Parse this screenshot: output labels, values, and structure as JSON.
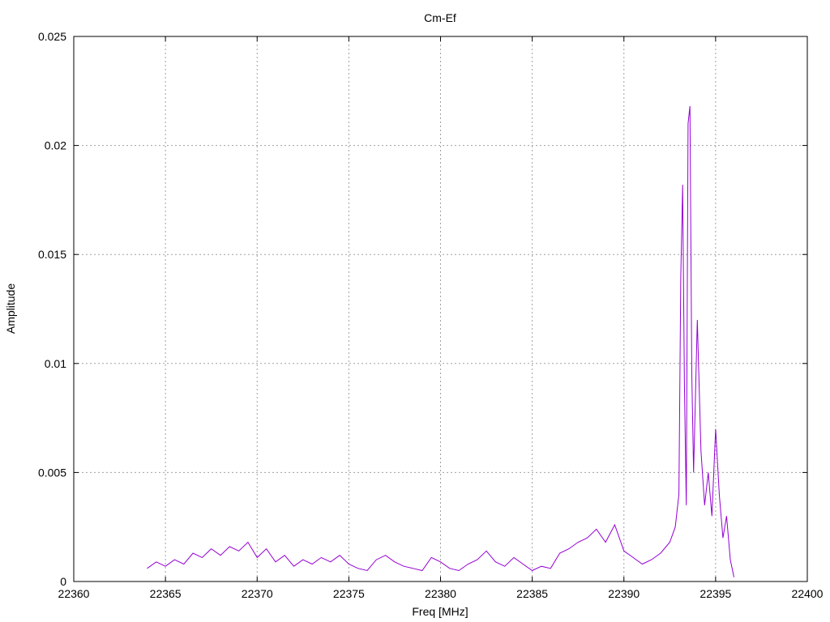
{
  "chart_data": {
    "type": "line",
    "title": "Cm-Ef",
    "xlabel": "Freq [MHz]",
    "ylabel": "Amplitude",
    "xlim": [
      22360,
      22400
    ],
    "ylim": [
      0,
      0.025
    ],
    "xticks": [
      22360,
      22365,
      22370,
      22375,
      22380,
      22385,
      22390,
      22395,
      22400
    ],
    "yticks": [
      0,
      0.005,
      0.01,
      0.015,
      0.02,
      0.025
    ],
    "xtick_labels": [
      "22360",
      "22365",
      "22370",
      "22375",
      "22380",
      "22385",
      "22390",
      "22395",
      "22400"
    ],
    "ytick_labels": [
      "0",
      "0.005",
      "0.01",
      "0.015",
      "0.02",
      "0.025"
    ],
    "grid": true,
    "legend": "none",
    "series": [
      {
        "color": "#9400d3",
        "x": [
          22364.0,
          22364.5,
          22365.0,
          22365.5,
          22366.0,
          22366.5,
          22367.0,
          22367.5,
          22368.0,
          22368.5,
          22369.0,
          22369.5,
          22370.0,
          22370.5,
          22371.0,
          22371.5,
          22372.0,
          22372.5,
          22373.0,
          22373.5,
          22374.0,
          22374.5,
          22375.0,
          22375.5,
          22376.0,
          22376.5,
          22377.0,
          22377.5,
          22378.0,
          22378.5,
          22379.0,
          22379.5,
          22380.0,
          22380.5,
          22381.0,
          22381.5,
          22382.0,
          22382.5,
          22383.0,
          22383.5,
          22384.0,
          22384.5,
          22385.0,
          22385.5,
          22386.0,
          22386.5,
          22387.0,
          22387.5,
          22388.0,
          22388.5,
          22389.0,
          22389.5,
          22390.0,
          22390.5,
          22391.0,
          22391.5,
          22392.0,
          22392.5,
          22392.8,
          22393.0,
          22393.1,
          22393.2,
          22393.3,
          22393.4,
          22393.5,
          22393.6,
          22393.7,
          22393.8,
          22394.0,
          22394.2,
          22394.4,
          22394.6,
          22394.8,
          22395.0,
          22395.2,
          22395.4,
          22395.6,
          22395.8,
          22396.0
        ],
        "values": [
          0.0006,
          0.0009,
          0.0007,
          0.001,
          0.0008,
          0.0013,
          0.0011,
          0.0015,
          0.0012,
          0.0016,
          0.0014,
          0.0018,
          0.0011,
          0.0015,
          0.0009,
          0.0012,
          0.0007,
          0.001,
          0.0008,
          0.0011,
          0.0009,
          0.0012,
          0.0008,
          0.0006,
          0.0005,
          0.001,
          0.0012,
          0.0009,
          0.0007,
          0.0006,
          0.0005,
          0.0011,
          0.0009,
          0.0006,
          0.0005,
          0.0008,
          0.001,
          0.0014,
          0.0009,
          0.0007,
          0.0011,
          0.0008,
          0.0005,
          0.0007,
          0.0006,
          0.0013,
          0.0015,
          0.0018,
          0.002,
          0.0024,
          0.0018,
          0.0026,
          0.0014,
          0.0011,
          0.0008,
          0.001,
          0.0013,
          0.0018,
          0.0025,
          0.004,
          0.014,
          0.0182,
          0.009,
          0.0035,
          0.021,
          0.0218,
          0.0095,
          0.005,
          0.012,
          0.006,
          0.0035,
          0.005,
          0.003,
          0.007,
          0.004,
          0.002,
          0.003,
          0.001,
          0.0002
        ]
      }
    ]
  }
}
